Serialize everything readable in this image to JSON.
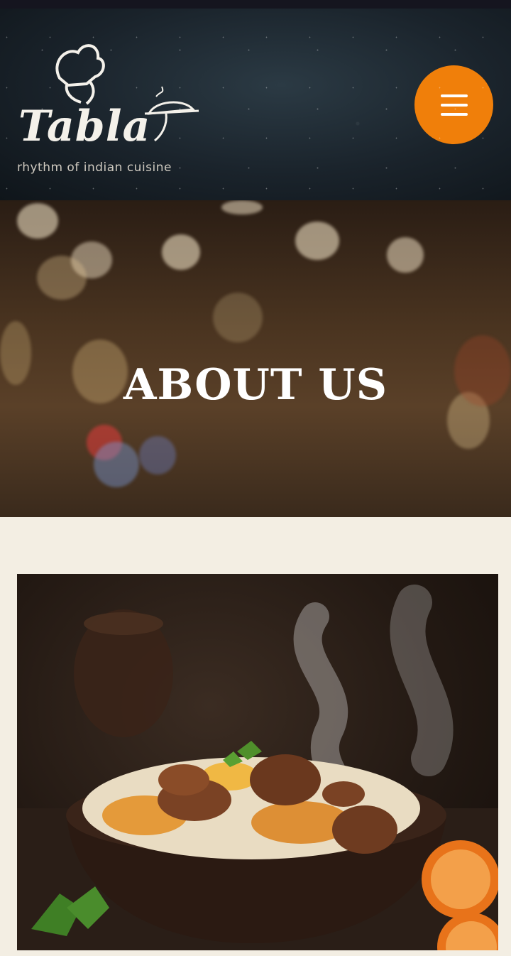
{
  "header": {
    "logo_name": "Tabla",
    "logo_tagline": "rhythm of indian cuisine",
    "menu_icon": "hamburger-menu-icon",
    "accent_color": "#f07f0a"
  },
  "hero": {
    "title": "ABOUT US"
  },
  "content": {
    "image": "biryani-bowl-photo"
  }
}
